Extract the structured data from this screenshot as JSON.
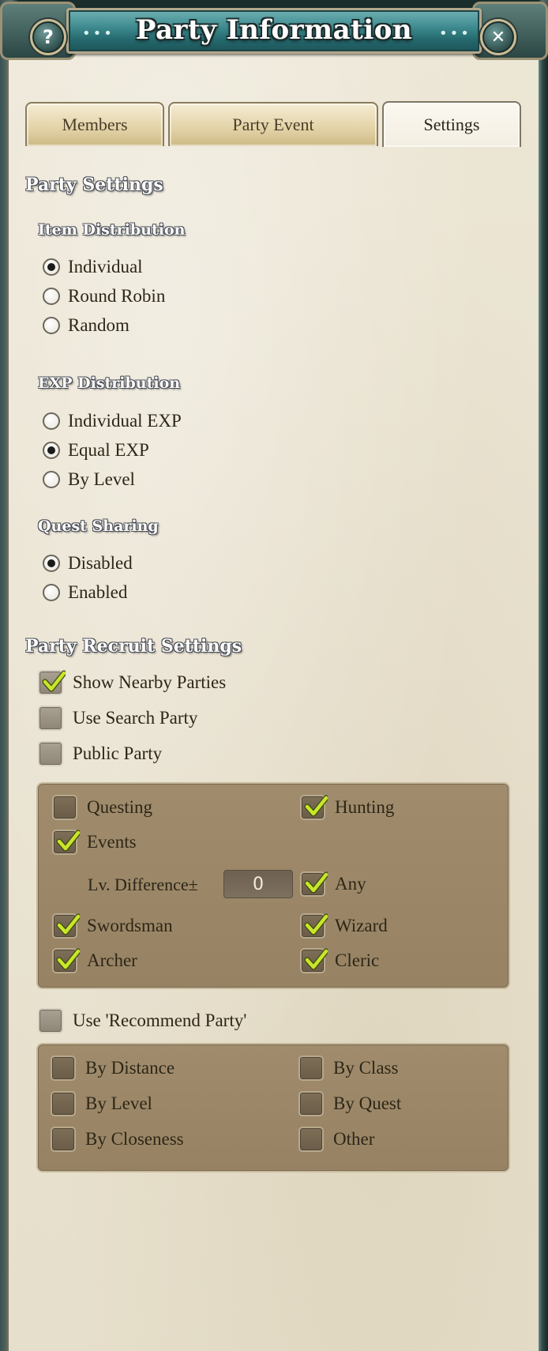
{
  "window": {
    "title": "Party Information",
    "help_glyph": "?",
    "close_glyph": "✕",
    "dots": "•••"
  },
  "tabs": [
    {
      "label": "Members",
      "active": false
    },
    {
      "label": "Party Event",
      "active": false
    },
    {
      "label": "Settings",
      "active": true
    }
  ],
  "party_settings": {
    "title": "Party Settings",
    "item_distribution": {
      "title": "Item Distribution",
      "options": [
        "Individual",
        "Round Robin",
        "Random"
      ],
      "selected": "Individual"
    },
    "exp_distribution": {
      "title": "EXP Distribution",
      "options": [
        "Individual EXP",
        "Equal EXP",
        "By Level"
      ],
      "selected": "Equal EXP"
    },
    "quest_sharing": {
      "title": "Quest Sharing",
      "options": [
        "Disabled",
        "Enabled"
      ],
      "selected": "Disabled"
    }
  },
  "recruit_settings": {
    "title": "Party Recruit Settings",
    "show_nearby": {
      "label": "Show Nearby Parties",
      "checked": true
    },
    "use_search": {
      "label": "Use Search Party",
      "checked": false
    },
    "public_party": {
      "label": "Public Party",
      "checked": false
    },
    "filters": {
      "questing": {
        "label": "Questing",
        "checked": false
      },
      "hunting": {
        "label": "Hunting",
        "checked": true
      },
      "events": {
        "label": "Events",
        "checked": true
      },
      "lv_difference_label": "Lv. Difference±",
      "lv_difference_value": "0",
      "any": {
        "label": "Any",
        "checked": true
      },
      "swordsman": {
        "label": "Swordsman",
        "checked": true
      },
      "wizard": {
        "label": "Wizard",
        "checked": true
      },
      "archer": {
        "label": "Archer",
        "checked": true
      },
      "cleric": {
        "label": "Cleric",
        "checked": true
      }
    },
    "recommend": {
      "label": "Use 'Recommend Party'",
      "checked": false
    },
    "recommend_options": {
      "by_distance": {
        "label": "By Distance",
        "checked": false
      },
      "by_class": {
        "label": "By Class",
        "checked": false
      },
      "by_level": {
        "label": "By Level",
        "checked": false
      },
      "by_quest": {
        "label": "By Quest",
        "checked": false
      },
      "by_closeness": {
        "label": "By Closeness",
        "checked": false
      },
      "other": {
        "label": "Other",
        "checked": false
      }
    }
  },
  "colors": {
    "tick": "#c8e62a",
    "paper": "#ebe4d2",
    "title_plate": "#3f8c90",
    "panel": "#9c8868"
  }
}
